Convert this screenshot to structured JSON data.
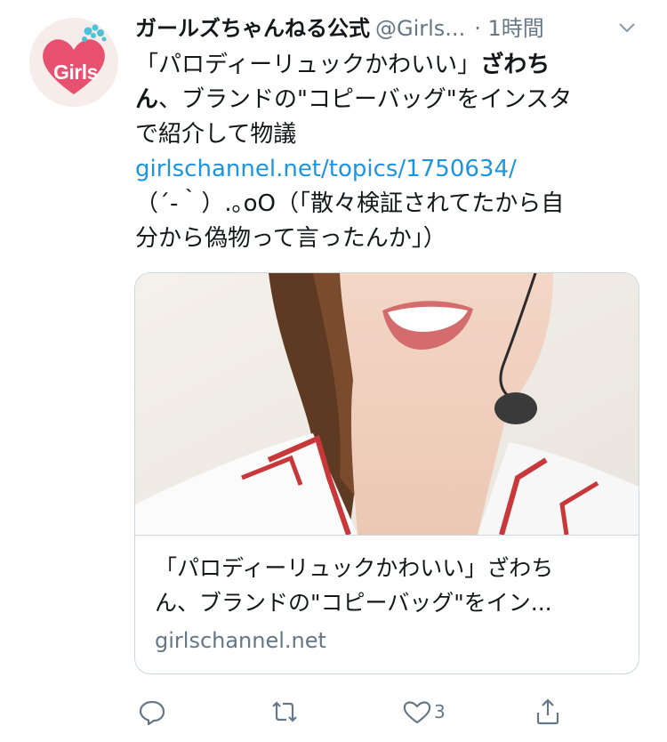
{
  "account": {
    "avatar_text": "Girls",
    "display_name": "ガールズちゃんねる公式",
    "handle": "@Girls...",
    "time": "· 1時間"
  },
  "tweet": {
    "line1": "「パロディーリュックかわいい」",
    "line1_bold": "ざわち",
    "line2_bold": "ん",
    "line2": "、ブランドの\"コピーバッグ\"をインスタ",
    "line3": "で紹介して物議",
    "link": "girlschannel.net/topics/1750634/",
    "line5": "（´-｀）.｡oO（「散々検証されてたから自",
    "line6": "分から偽物って言ったんか」）"
  },
  "card": {
    "title_line1": "「パロディーリュックかわいい」ざわち",
    "title_line2": "ん、ブランドの\"コピーバッグ\"をイン...",
    "domain": "girlschannel.net"
  },
  "actions": {
    "like_count": "3"
  },
  "colors": {
    "link": "#1b95e0",
    "muted": "#657786",
    "avatar_heart": "#e8506f",
    "avatar_bubble": "#4cc2d9"
  },
  "icons": [
    "caret-down-icon",
    "reply-icon",
    "retweet-icon",
    "like-icon",
    "share-icon"
  ]
}
